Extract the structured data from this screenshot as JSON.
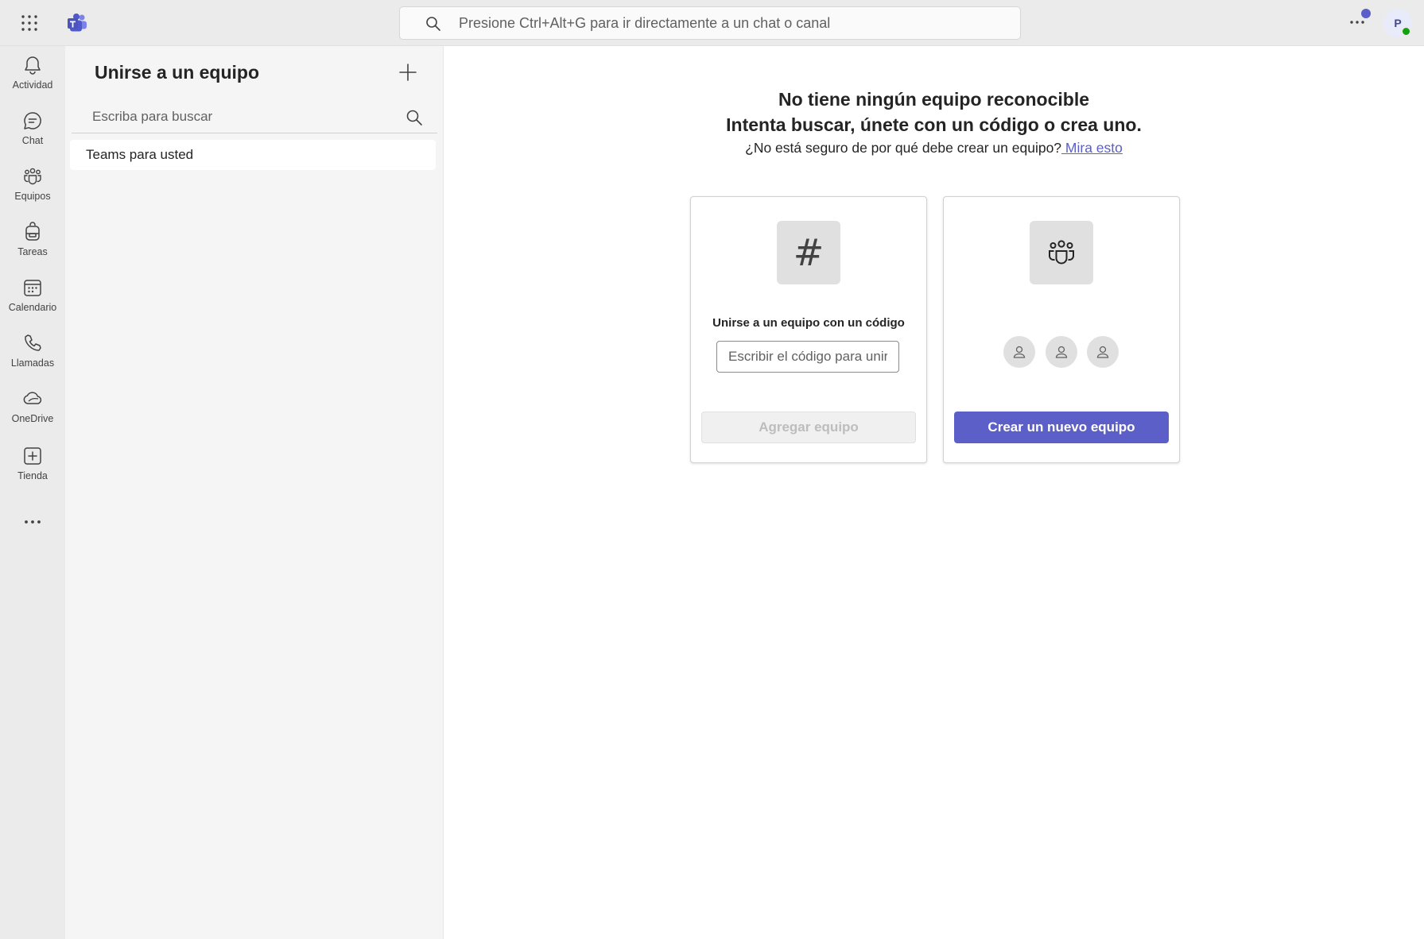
{
  "topbar": {
    "search_placeholder": "Presione Ctrl+Alt+G para ir directamente a un chat o canal",
    "avatar_initial": "P"
  },
  "rail": {
    "items": [
      {
        "label": "Actividad",
        "icon": "bell-icon"
      },
      {
        "label": "Chat",
        "icon": "chat-icon"
      },
      {
        "label": "Equipos",
        "icon": "teams-icon"
      },
      {
        "label": "Tareas",
        "icon": "backpack-icon"
      },
      {
        "label": "Calendario",
        "icon": "calendar-icon"
      },
      {
        "label": "Llamadas",
        "icon": "phone-icon"
      },
      {
        "label": "OneDrive",
        "icon": "cloud-icon"
      },
      {
        "label": "Tienda",
        "icon": "add-app-icon"
      }
    ]
  },
  "panel": {
    "title": "Unirse a un equipo",
    "search_placeholder": "Escriba para buscar",
    "items": [
      {
        "label": "Teams para usted"
      }
    ]
  },
  "main": {
    "headline1": "No tiene ningún equipo reconocible",
    "headline2": "Intenta buscar, únete con un código o crea uno.",
    "subline": "¿No está seguro de por qué debe crear un equipo?",
    "subline_link": " Mira esto",
    "join_card": {
      "label": "Unirse a un equipo con un código",
      "input_placeholder": "Escribir el código para unirse",
      "button": "Agregar equipo"
    },
    "create_card": {
      "button": "Crear un nuevo equipo"
    }
  },
  "colors": {
    "accent": "#5b5fc7",
    "presence": "#13a10e",
    "rail_bg": "#ebebeb",
    "panel_bg": "#f5f5f5"
  }
}
